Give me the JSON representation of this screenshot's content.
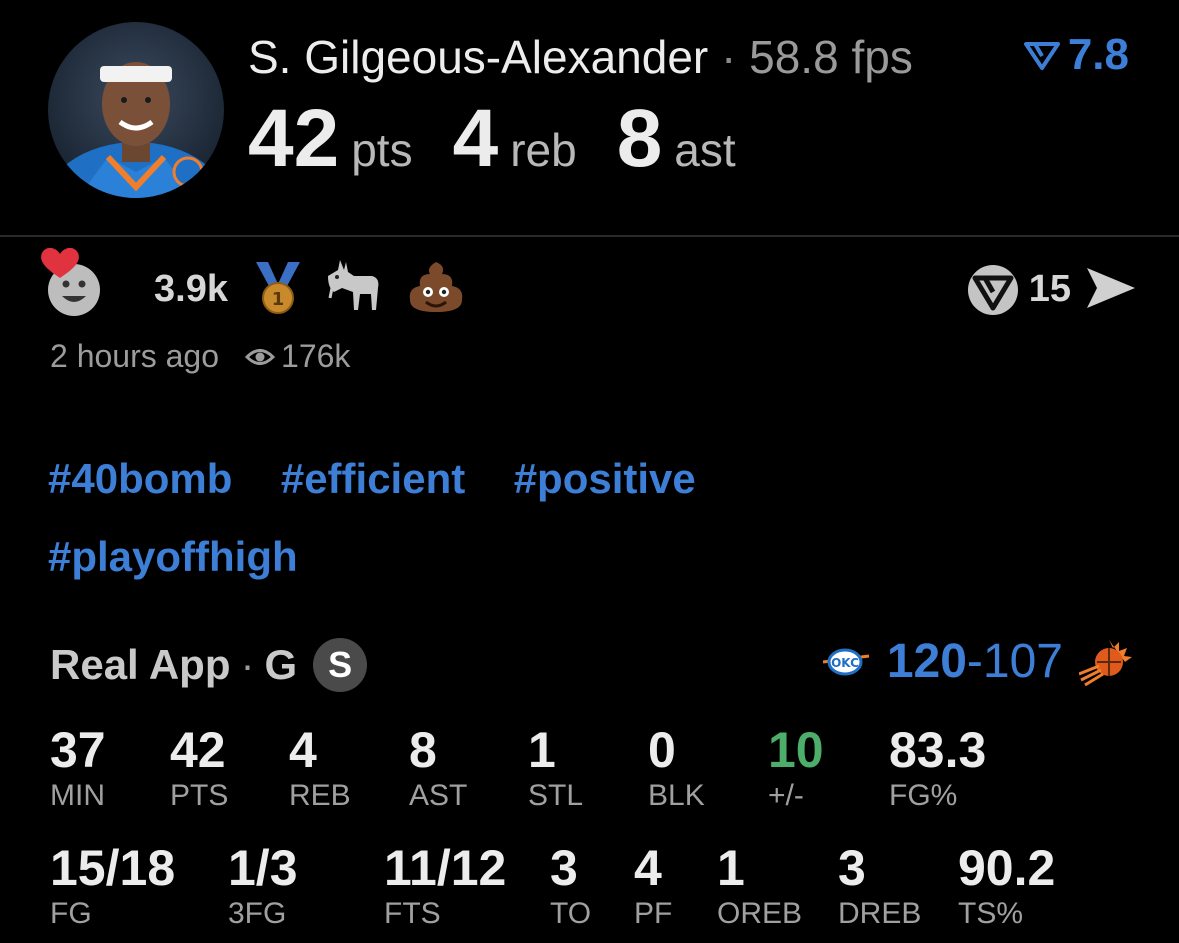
{
  "player": {
    "name": "S. Gilgeous-Alexander",
    "separator": "·",
    "fps": "58.8 fps",
    "rating": "7.8",
    "points": "42",
    "points_unit": "pts",
    "rebounds": "4",
    "rebounds_unit": "reb",
    "assists": "8",
    "assists_unit": "ast"
  },
  "reactions": {
    "count": "3.9k",
    "emojis": [
      "medal-icon",
      "goat-icon",
      "poop-icon"
    ],
    "replies": "15"
  },
  "meta": {
    "time_ago": "2 hours ago",
    "views": "176k"
  },
  "tags": [
    "#40bomb",
    "#efficient",
    "#positive",
    "#playoffhigh"
  ],
  "source": {
    "app": "Real App",
    "separator": "·",
    "position": "G",
    "badge": "S"
  },
  "score": {
    "team": "120",
    "dash": "-",
    "opponent": "107"
  },
  "stats_row1": [
    {
      "v": "37",
      "l": "MIN"
    },
    {
      "v": "42",
      "l": "PTS"
    },
    {
      "v": "4",
      "l": "REB"
    },
    {
      "v": "8",
      "l": "AST"
    },
    {
      "v": "1",
      "l": "STL"
    },
    {
      "v": "0",
      "l": "BLK"
    },
    {
      "v": "10",
      "l": "+/-"
    },
    {
      "v": "83.3",
      "l": "FG%"
    }
  ],
  "stats_row2": [
    {
      "v": "15/18",
      "l": "FG"
    },
    {
      "v": "1/3",
      "l": "3FG"
    },
    {
      "v": "11/12",
      "l": "FTS"
    },
    {
      "v": "3",
      "l": "TO"
    },
    {
      "v": "4",
      "l": "PF"
    },
    {
      "v": "1",
      "l": "OREB"
    },
    {
      "v": "3",
      "l": "DREB"
    },
    {
      "v": "90.2",
      "l": "TS%"
    }
  ],
  "colors": {
    "accent": "#3d7fd6",
    "positive": "#4cae6a",
    "background": "#000000"
  }
}
